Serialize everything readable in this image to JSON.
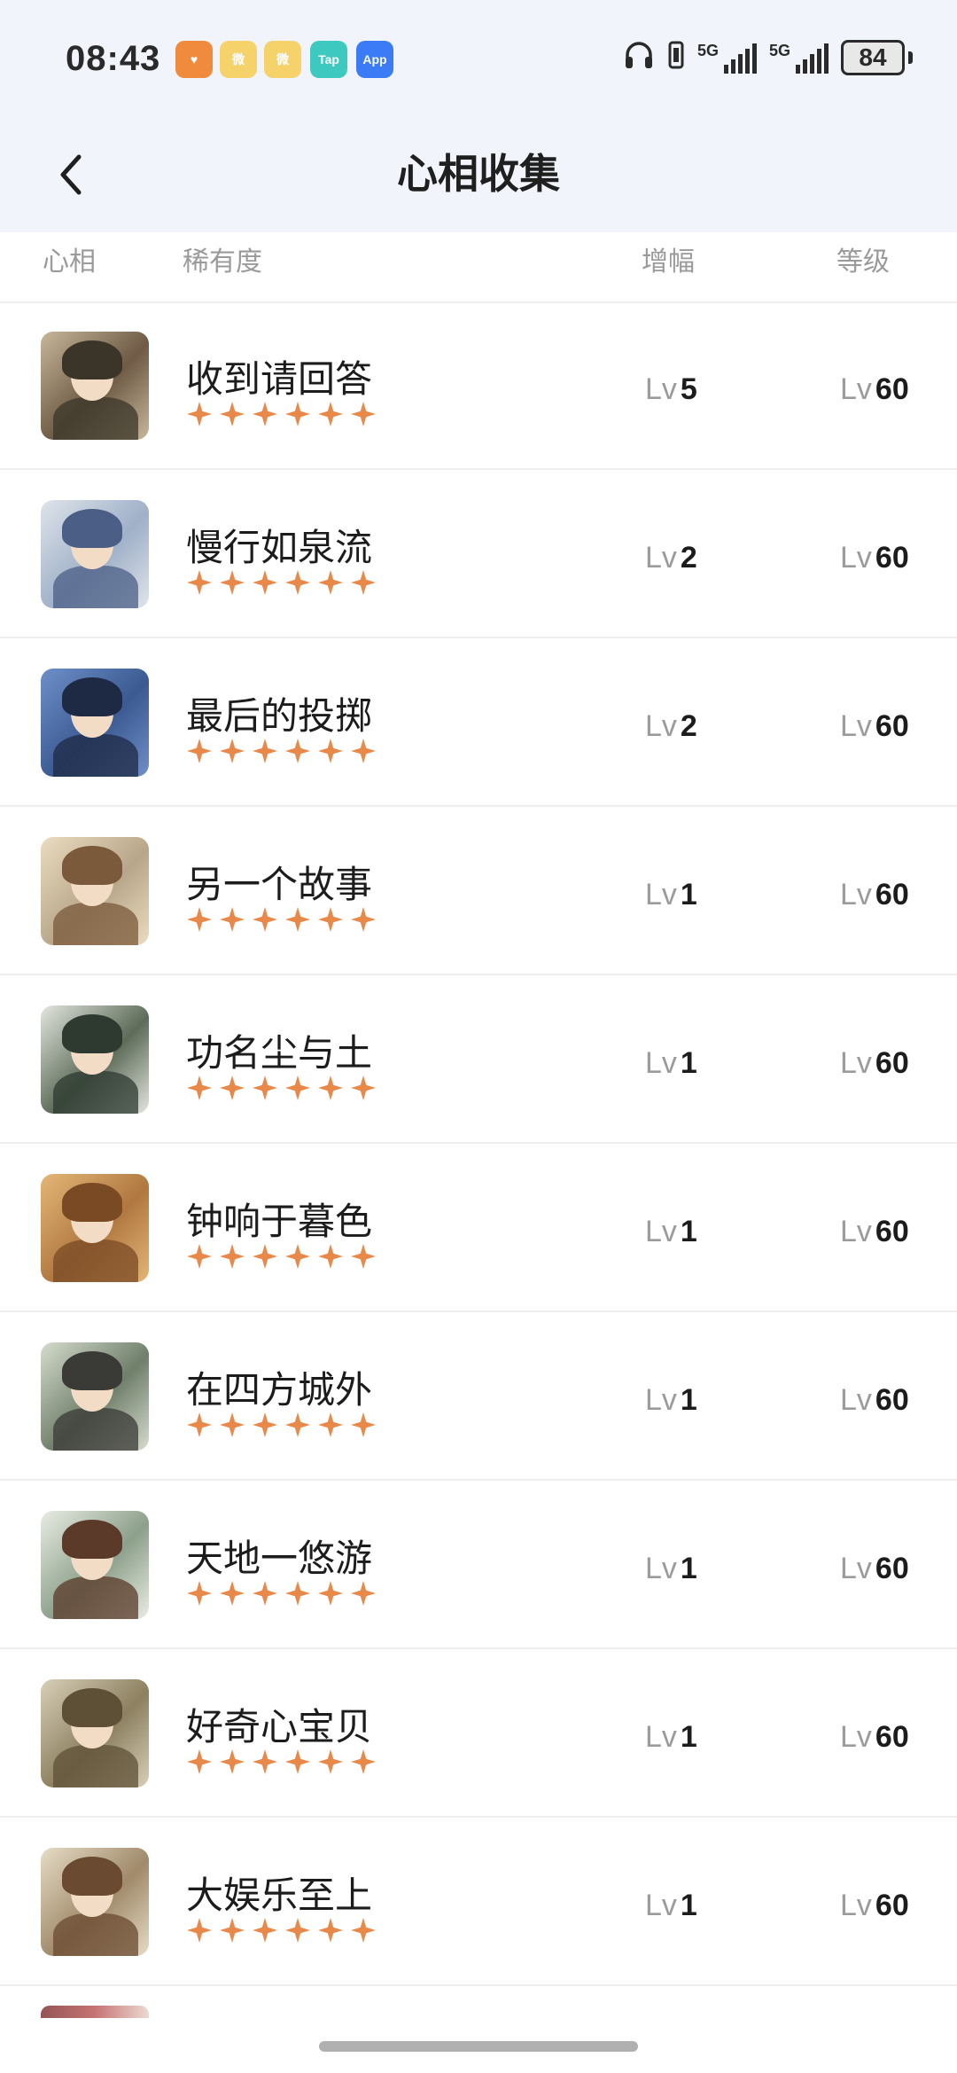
{
  "status_bar": {
    "time": "08:43",
    "notifications": [
      {
        "icon": "health-app-icon",
        "color": "#f08a3c",
        "label": "♥"
      },
      {
        "icon": "weibo-icon",
        "color": "#f6d26b",
        "label": "微"
      },
      {
        "icon": "weibo-icon",
        "color": "#f6d26b",
        "label": "微"
      },
      {
        "icon": "taptap-icon",
        "color": "#3ec9c0",
        "label": "Tap"
      },
      {
        "icon": "app-market-icon",
        "color": "#3b7bf6",
        "label": "App"
      }
    ],
    "network_1": "5G",
    "network_2": "5G",
    "battery": "84"
  },
  "header": {
    "title": "心相收集",
    "back_icon": "chevron-left-icon"
  },
  "columns": {
    "portrait": "心相",
    "rarity": "稀有度",
    "boost": "增幅",
    "level": "等级"
  },
  "lv_prefix": "Lv",
  "star_color": "#e8894a",
  "items": [
    {
      "name": "收到请回答",
      "stars": 6,
      "boost": "5",
      "level": "60",
      "palette": [
        "#c7b79a",
        "#3a3528",
        "#6e5a45"
      ]
    },
    {
      "name": "慢行如泉流",
      "stars": 6,
      "boost": "2",
      "level": "60",
      "palette": [
        "#dfe4ea",
        "#4b5f86",
        "#9fb0c8"
      ]
    },
    {
      "name": "最后的投掷",
      "stars": 6,
      "boost": "2",
      "level": "60",
      "palette": [
        "#6f8fc9",
        "#1e2a44",
        "#3b5a92"
      ]
    },
    {
      "name": "另一个故事",
      "stars": 6,
      "boost": "1",
      "level": "60",
      "palette": [
        "#eadcc0",
        "#7a5a3a",
        "#b8a68a"
      ]
    },
    {
      "name": "功名尘与土",
      "stars": 6,
      "boost": "1",
      "level": "60",
      "palette": [
        "#e3e6df",
        "#2e3a30",
        "#5d6b58"
      ]
    },
    {
      "name": "钟响于暮色",
      "stars": 6,
      "boost": "1",
      "level": "60",
      "palette": [
        "#e4b677",
        "#7a4a24",
        "#b07840"
      ]
    },
    {
      "name": "在四方城外",
      "stars": 6,
      "boost": "1",
      "level": "60",
      "palette": [
        "#d6dccd",
        "#3a3a36",
        "#6f7f6a"
      ]
    },
    {
      "name": "天地一悠游",
      "stars": 6,
      "boost": "1",
      "level": "60",
      "palette": [
        "#e9ece4",
        "#5b3a2a",
        "#8ca08a"
      ]
    },
    {
      "name": "好奇心宝贝",
      "stars": 6,
      "boost": "1",
      "level": "60",
      "palette": [
        "#d8cfb8",
        "#5e5036",
        "#8c8060"
      ]
    },
    {
      "name": "大娱乐至上",
      "stars": 6,
      "boost": "1",
      "level": "60",
      "palette": [
        "#e6dcc6",
        "#6a4a30",
        "#a08a6a"
      ]
    }
  ]
}
